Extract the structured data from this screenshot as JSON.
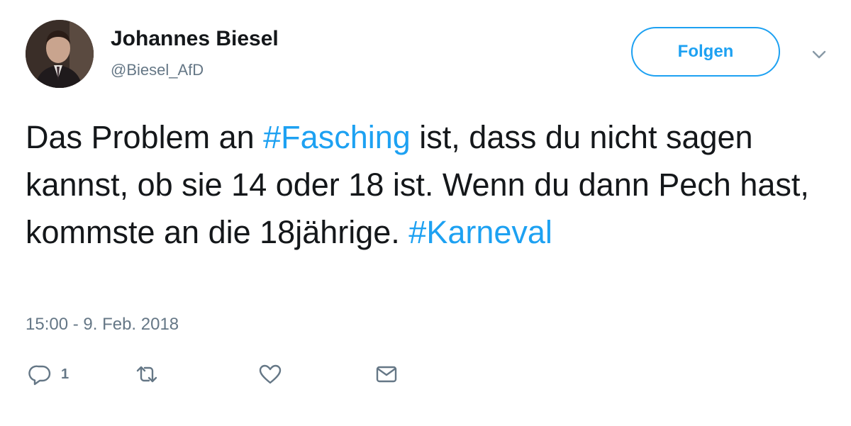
{
  "author": {
    "display_name": "Johannes Biesel",
    "handle": "@Biesel_AfD"
  },
  "follow_button": {
    "label": "Folgen"
  },
  "tweet": {
    "text_parts": [
      {
        "text": "Das Problem an ",
        "type": "text"
      },
      {
        "text": "#Fasching",
        "type": "hashtag"
      },
      {
        "text": " ist, dass du nicht sagen kannst, ob sie 14 oder 18 ist. Wenn du dann Pech hast, kommste an die 18jährige. ",
        "type": "text"
      },
      {
        "text": "#Karneval",
        "type": "hashtag"
      }
    ],
    "timestamp": "15:00 - 9. Feb. 2018"
  },
  "actions": {
    "reply_count": "1",
    "reply_icon": "reply-icon",
    "retweet_icon": "retweet-icon",
    "like_icon": "heart-icon",
    "dm_icon": "envelope-icon"
  },
  "colors": {
    "accent": "#1da1f2",
    "text": "#14171a",
    "secondary": "#657786"
  }
}
